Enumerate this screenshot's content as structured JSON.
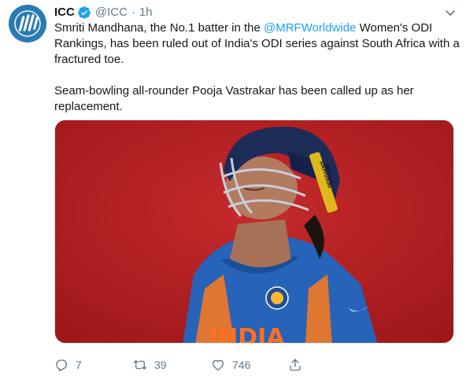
{
  "tweet": {
    "author_name": "ICC",
    "handle": "@ICC",
    "separator": "·",
    "time": "1h",
    "text_part1": "Smriti Mandhana, the No.1 batter in the ",
    "mention": "@MRFWorldwide",
    "text_part2": " Women's ODI Rankings, has been ruled out of India's ODI series against South Africa with a fractured toe.",
    "text_paragraph2": "Seam-bowling all-rounder Pooja Vastrakar has been called up as her replacement."
  },
  "media": {
    "helmet_brand": "SAMURAI",
    "jersey_text": "INDIA"
  },
  "actions": {
    "replies": "7",
    "retweets": "39",
    "likes": "746"
  },
  "colors": {
    "accent": "#1da1f2",
    "muted": "#657786",
    "background_red": "#b21f23"
  },
  "icons": [
    "icc-logo",
    "verified-badge-icon",
    "chevron-down-icon",
    "reply-icon",
    "retweet-icon",
    "like-icon",
    "share-icon"
  ]
}
